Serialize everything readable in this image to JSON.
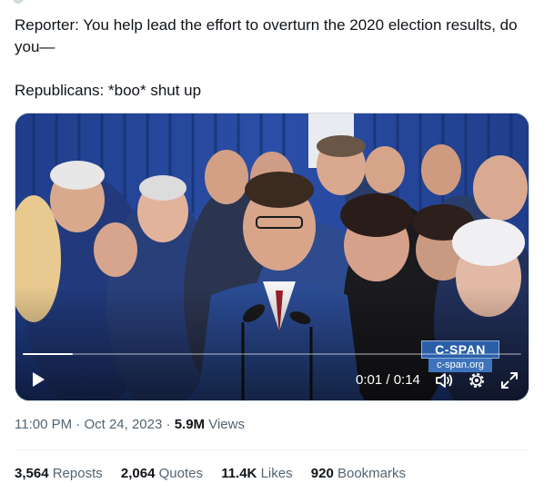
{
  "tweet": {
    "text_line1": "Reporter: You help lead the effort to overturn the 2020 election results, do you—",
    "text_line2": "Republicans: *boo* shut up"
  },
  "video": {
    "timecode": "0:01 / 0:14",
    "progress_fraction": 0.1,
    "logo_title": "C-SPAN",
    "logo_subtitle": "c-span.org",
    "play_icon": "play-icon",
    "volume_icon": "volume-icon",
    "settings_icon": "gear-icon",
    "fullscreen_icon": "fullscreen-icon"
  },
  "meta": {
    "time": "11:00 PM",
    "separator": "·",
    "date": "Oct 24, 2023",
    "views_count": "5.9M",
    "views_label": "Views"
  },
  "stats": [
    {
      "count": "3,564",
      "label": "Reposts"
    },
    {
      "count": "2,064",
      "label": "Quotes"
    },
    {
      "count": "11.4K",
      "label": "Likes"
    },
    {
      "count": "920",
      "label": "Bookmarks"
    }
  ],
  "colors": {
    "text_primary": "#0f1419",
    "text_secondary": "#536471",
    "divider": "#eff3f4",
    "cspan_blue": "#2a5fa8"
  }
}
